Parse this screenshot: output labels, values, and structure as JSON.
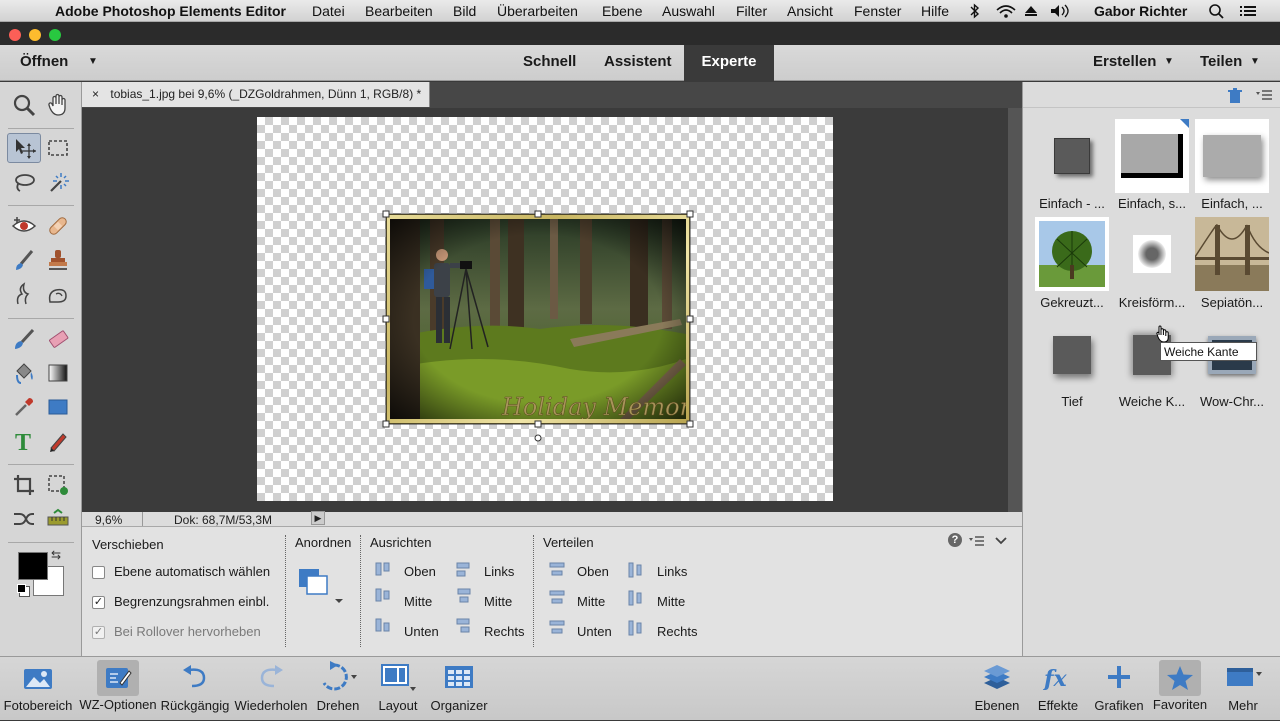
{
  "menubar": {
    "app": "Adobe Photoshop Elements Editor",
    "items": [
      "Datei",
      "Bearbeiten",
      "Bild",
      "Überarbeiten",
      "Ebene",
      "Auswahl",
      "Filter",
      "Ansicht",
      "Fenster",
      "Hilfe"
    ],
    "user": "Gabor Richter"
  },
  "topbar": {
    "open": "Öffnen",
    "modes": [
      "Schnell",
      "Assistent",
      "Experte"
    ],
    "create": "Erstellen",
    "share": "Teilen"
  },
  "document": {
    "tab_title": "tobias_1.jpg bei 9,6% (_DZGoldrahmen, Dünn 1, RGB/8) *",
    "close": "×",
    "photo_caption": "Holiday Memories"
  },
  "status": {
    "zoom": "9,6%",
    "doc": "Dok: 68,7M/53,3M"
  },
  "options": {
    "tool": "Verschieben",
    "auto_select": "Ebene automatisch wählen",
    "show_bbox": "Begrenzungsrahmen einbl.",
    "rollover": "Bei Rollover hervorheben",
    "arrange": "Anordnen",
    "align": "Ausrichten",
    "distribute": "Verteilen",
    "align_items": [
      "Oben",
      "Links",
      "Mitte",
      "Mitte",
      "Unten",
      "Rechts"
    ],
    "distribute_items": [
      "Oben",
      "Links",
      "Mitte",
      "Mitte",
      "Unten",
      "Rechts"
    ]
  },
  "effects": {
    "items": [
      "Einfach - ...",
      "Einfach, s...",
      "Einfach, ...",
      "Gekreuzt...",
      "Kreisförm...",
      "Sepiatön...",
      "Tief",
      "Weiche K...",
      "Wow-Chr..."
    ],
    "tooltip": "Weiche Kante"
  },
  "bottombar": {
    "left": [
      "Fotobereich",
      "WZ-Optionen",
      "Rückgängig",
      "Wiederholen",
      "Drehen",
      "Layout",
      "Organizer"
    ],
    "right": [
      "Ebenen",
      "Effekte",
      "Grafiken",
      "Favoriten",
      "Mehr"
    ]
  },
  "colors": {
    "accent": "#3e7bc4",
    "selected_tool": "#b8c4d4",
    "dark_workspace": "#3b3b3b"
  }
}
